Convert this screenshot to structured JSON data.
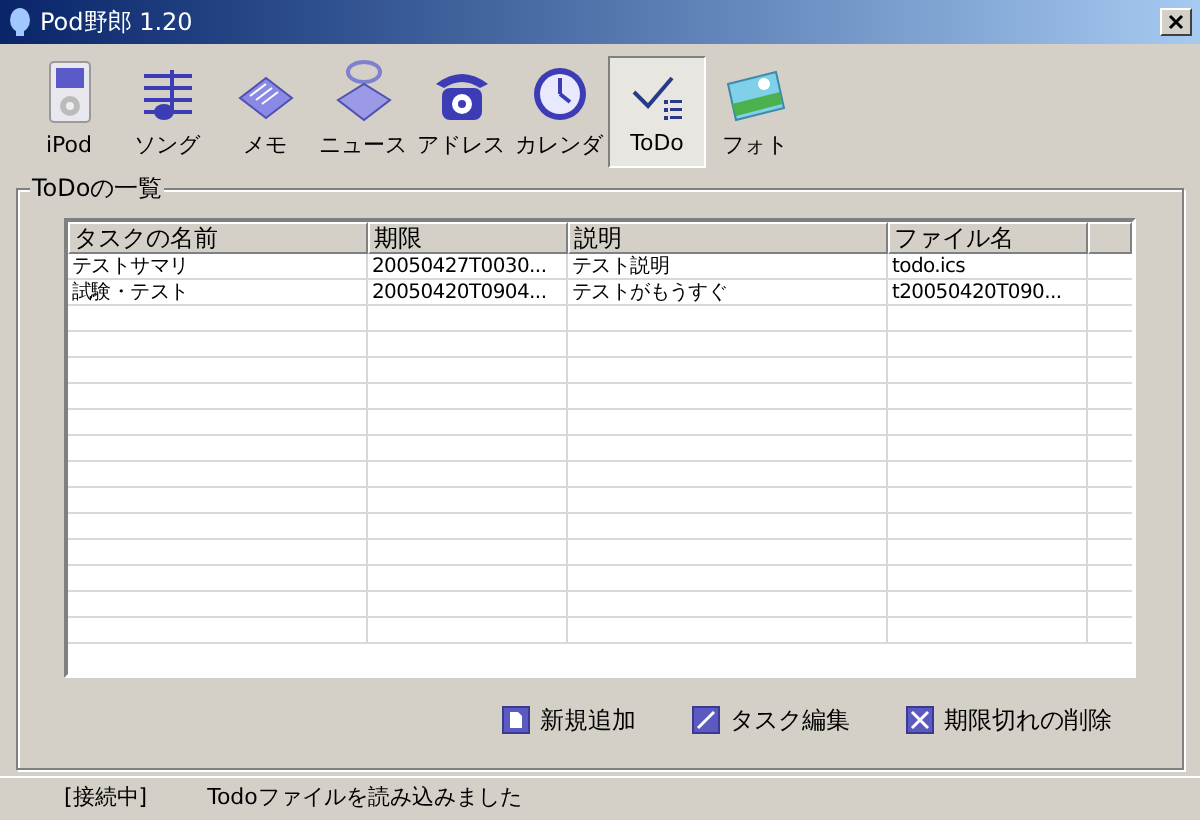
{
  "window": {
    "title": "Pod野郎 1.20"
  },
  "toolbar": [
    {
      "label": "iPod",
      "selected": false
    },
    {
      "label": "ソング",
      "selected": false
    },
    {
      "label": "メモ",
      "selected": false
    },
    {
      "label": "ニュース",
      "selected": false
    },
    {
      "label": "アドレス",
      "selected": false
    },
    {
      "label": "カレンダ",
      "selected": false
    },
    {
      "label": "ToDo",
      "selected": true
    },
    {
      "label": "フォト",
      "selected": false
    }
  ],
  "group": {
    "title": "ToDoの一覧"
  },
  "table": {
    "columns": [
      "タスクの名前",
      "期限",
      "説明",
      "ファイル名"
    ],
    "rows": [
      [
        "テストサマリ",
        "20050427T0030...",
        "テスト説明",
        "todo.ics"
      ],
      [
        "試験・テスト",
        "20050420T0904...",
        "テストがもうすぐ",
        "t20050420T090..."
      ]
    ]
  },
  "actions": [
    "新規追加",
    "タスク編集",
    "期限切れの削除"
  ],
  "status_bar": {
    "state": "[接続中]",
    "message": "Todoファイルを読み込みました"
  }
}
